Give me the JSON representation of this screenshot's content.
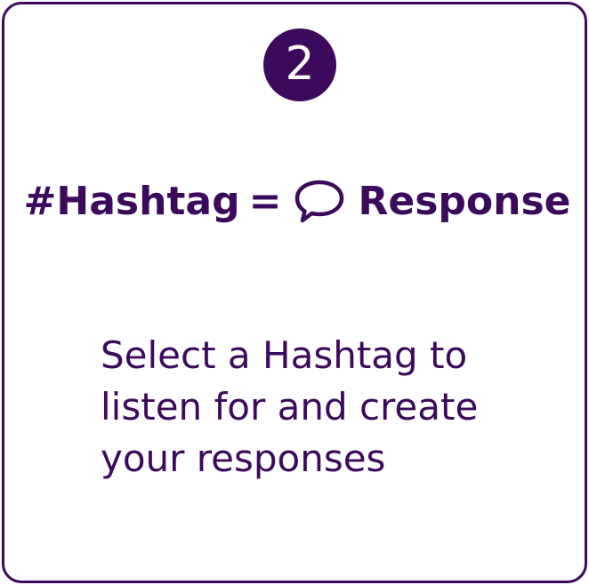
{
  "card": {
    "step_number": "2",
    "headline": {
      "hashtag": "#Hashtag",
      "equals": "=",
      "response": "Response"
    },
    "description": "Select a Hashtag to listen for and create your responses"
  },
  "icons": {
    "speech_bubble": "speech-bubble-icon"
  },
  "colors": {
    "brand_purple": "#3c0a5c",
    "background": "#ffffff"
  }
}
